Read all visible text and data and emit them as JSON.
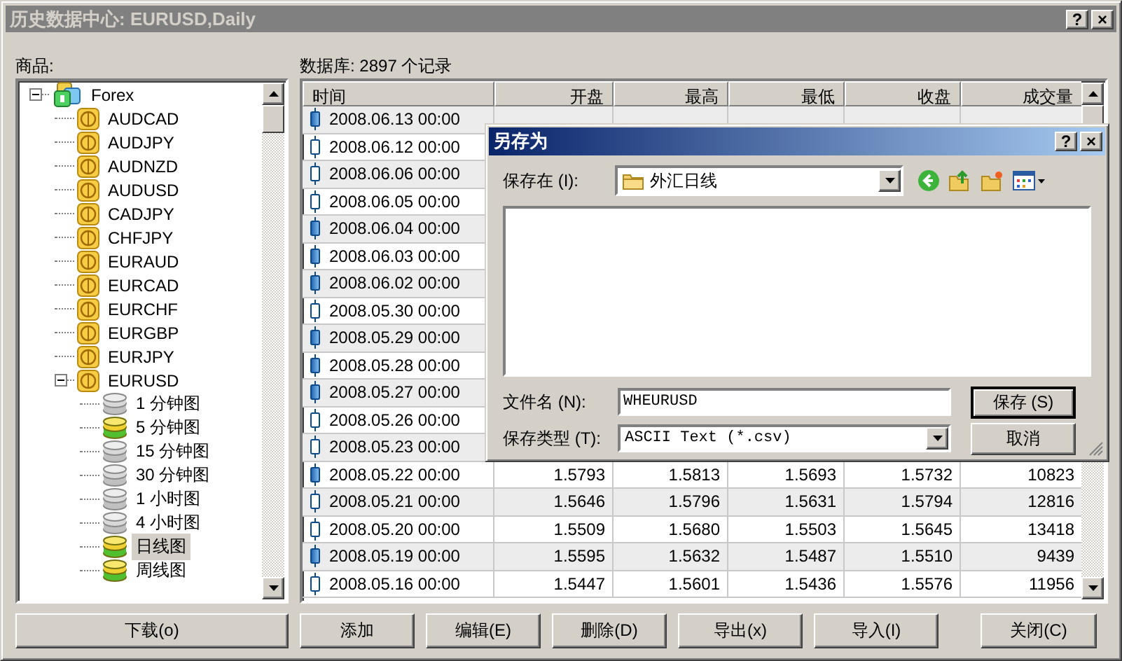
{
  "window": {
    "title": "历史数据中心: EURUSD,Daily",
    "title_buttons": [
      "?",
      "×"
    ]
  },
  "symbols_label": "商品:",
  "tree": [
    {
      "label": "Forex",
      "kind": "group",
      "expanded": true,
      "children": [
        {
          "label": "AUDCAD",
          "kind": "symbol"
        },
        {
          "label": "AUDJPY",
          "kind": "symbol"
        },
        {
          "label": "AUDNZD",
          "kind": "symbol"
        },
        {
          "label": "AUDUSD",
          "kind": "symbol"
        },
        {
          "label": "CADJPY",
          "kind": "symbol"
        },
        {
          "label": "CHFJPY",
          "kind": "symbol"
        },
        {
          "label": "EURAUD",
          "kind": "symbol"
        },
        {
          "label": "EURCAD",
          "kind": "symbol"
        },
        {
          "label": "EURCHF",
          "kind": "symbol"
        },
        {
          "label": "EURGBP",
          "kind": "symbol"
        },
        {
          "label": "EURJPY",
          "kind": "symbol"
        },
        {
          "label": "EURUSD",
          "kind": "symbol",
          "expanded": true,
          "children": [
            {
              "label": "1 分钟图",
              "kind": "period",
              "available": false,
              "selected": false
            },
            {
              "label": "5 分钟图",
              "kind": "period",
              "available": true,
              "selected": false
            },
            {
              "label": "15 分钟图",
              "kind": "period",
              "available": false,
              "selected": false
            },
            {
              "label": "30 分钟图",
              "kind": "period",
              "available": false,
              "selected": false
            },
            {
              "label": "1 小时图",
              "kind": "period",
              "available": false,
              "selected": false
            },
            {
              "label": "4 小时图",
              "kind": "period",
              "available": false,
              "selected": false
            },
            {
              "label": "日线图",
              "kind": "period",
              "available": true,
              "selected": true
            },
            {
              "label": "周线图",
              "kind": "period",
              "available": true,
              "selected": false
            }
          ]
        }
      ]
    }
  ],
  "database_label": "数据库: 2897 个记录",
  "table": {
    "columns": [
      "时间",
      "开盘",
      "最高",
      "最低",
      "收盘",
      "成交量"
    ],
    "rows": [
      {
        "filled": true,
        "cells": [
          "2008.06.13 00:00"
        ]
      },
      {
        "filled": false,
        "cells": [
          "2008.06.12 00:00"
        ]
      },
      {
        "filled": false,
        "cells": [
          "2008.06.06 00:00"
        ]
      },
      {
        "filled": false,
        "cells": [
          "2008.06.05 00:00"
        ]
      },
      {
        "filled": true,
        "cells": [
          "2008.06.04 00:00"
        ]
      },
      {
        "filled": true,
        "cells": [
          "2008.06.03 00:00"
        ]
      },
      {
        "filled": true,
        "cells": [
          "2008.06.02 00:00"
        ]
      },
      {
        "filled": false,
        "cells": [
          "2008.05.30 00:00"
        ]
      },
      {
        "filled": true,
        "cells": [
          "2008.05.29 00:00"
        ]
      },
      {
        "filled": true,
        "cells": [
          "2008.05.28 00:00"
        ]
      },
      {
        "filled": true,
        "cells": [
          "2008.05.27 00:00"
        ]
      },
      {
        "filled": false,
        "cells": [
          "2008.05.26 00:00"
        ]
      },
      {
        "filled": false,
        "cells": [
          "2008.05.23 00:00"
        ]
      },
      {
        "filled": true,
        "cells": [
          "2008.05.22 00:00",
          "1.5793",
          "1.5813",
          "1.5693",
          "1.5732",
          "10823"
        ]
      },
      {
        "filled": false,
        "cells": [
          "2008.05.21 00:00",
          "1.5646",
          "1.5796",
          "1.5631",
          "1.5794",
          "12816"
        ]
      },
      {
        "filled": false,
        "cells": [
          "2008.05.20 00:00",
          "1.5509",
          "1.5680",
          "1.5503",
          "1.5645",
          "13418"
        ]
      },
      {
        "filled": true,
        "cells": [
          "2008.05.19 00:00",
          "1.5595",
          "1.5632",
          "1.5487",
          "1.5510",
          "9439"
        ]
      },
      {
        "filled": false,
        "cells": [
          "2008.05.16 00:00",
          "1.5447",
          "1.5601",
          "1.5436",
          "1.5576",
          "11956"
        ]
      }
    ]
  },
  "buttons": [
    "下载(o)",
    "添加",
    "编辑(E)",
    "删除(D)",
    "导出(x)",
    "导入(I)",
    "关闭(C)"
  ],
  "dialog": {
    "title": "另存为",
    "title_buttons": [
      "?",
      "×"
    ],
    "save_in_label": "保存在 (I):",
    "save_in": "外汇日线",
    "file_name_label": "文件名 (N):",
    "file_name": "WHEURUSD",
    "file_type_label": "保存类型 (T):",
    "file_type": "ASCII Text (*.csv)",
    "buttons": [
      {
        "label": "保存 (S)",
        "default": true
      },
      {
        "label": "取消",
        "default": false
      }
    ]
  }
}
